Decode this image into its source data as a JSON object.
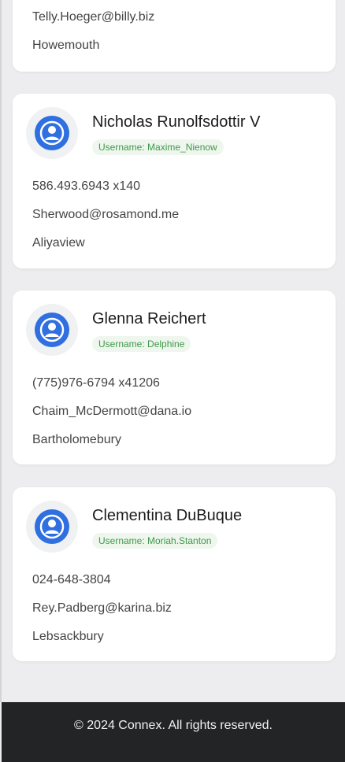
{
  "contacts": [
    {
      "email": "Telly.Hoeger@billy.biz",
      "city": "Howemouth"
    },
    {
      "name": "Nicholas Runolfsdottir V",
      "username": "Username: Maxime_Nienow",
      "phone": "586.493.6943 x140",
      "email": "Sherwood@rosamond.me",
      "city": "Aliyaview"
    },
    {
      "name": "Glenna Reichert",
      "username": "Username: Delphine",
      "phone": "(775)976-6794 x41206",
      "email": "Chaim_McDermott@dana.io",
      "city": "Bartholomebury"
    },
    {
      "name": "Clementina DuBuque",
      "username": "Username: Moriah.Stanton",
      "phone": "024-648-3804",
      "email": "Rey.Padberg@karina.biz",
      "city": "Lebsackbury"
    }
  ],
  "footer": {
    "copyright": "© 2024 Connex. All rights reserved."
  },
  "colors": {
    "accent": "#2f6fe0",
    "badge_text": "#3e9a4a",
    "badge_bg": "#eef6ee",
    "footer_bg": "#222426",
    "page_bg": "#ededef"
  },
  "icons": {
    "avatar": "user-avatar-icon"
  }
}
